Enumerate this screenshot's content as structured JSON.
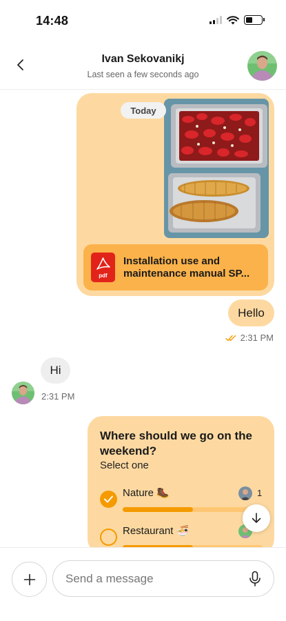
{
  "status_bar": {
    "time": "14:48"
  },
  "header": {
    "name": "Ivan Sekovanikj",
    "status": "Last seen a few seconds ago"
  },
  "conversation": {
    "date_label": "Today",
    "attachment": {
      "file_name": "Installation use and maintenance manual SP...",
      "type_label": "pdf"
    },
    "outgoing_text": {
      "text": "Hello",
      "time": "2:31 PM"
    },
    "incoming_text": {
      "text": "Hi",
      "time": "2:31 PM"
    },
    "poll": {
      "question": "Where should we go on the weekend?",
      "hint": "Select one",
      "options": [
        {
          "label": "Nature 🥾",
          "votes": "1",
          "selected": true,
          "fill_fraction": 0.5
        },
        {
          "label": "Restaurant 🍜",
          "votes": "",
          "selected": false,
          "fill_fraction": 0.5
        }
      ]
    }
  },
  "composer": {
    "placeholder": "Send a message"
  },
  "colors": {
    "outgoing_bubble": "#fdd9a1",
    "attachment_card": "#fbb24b",
    "poll_accent": "#f59a00",
    "incoming_bubble": "#eeeeee",
    "pdf_red": "#e2231a"
  },
  "icons": {
    "back": "chevron-left-icon",
    "read_receipt": "double-check-icon",
    "scroll": "arrow-down-icon",
    "add": "plus-icon",
    "mic": "microphone-icon",
    "file": "pdf-icon"
  }
}
